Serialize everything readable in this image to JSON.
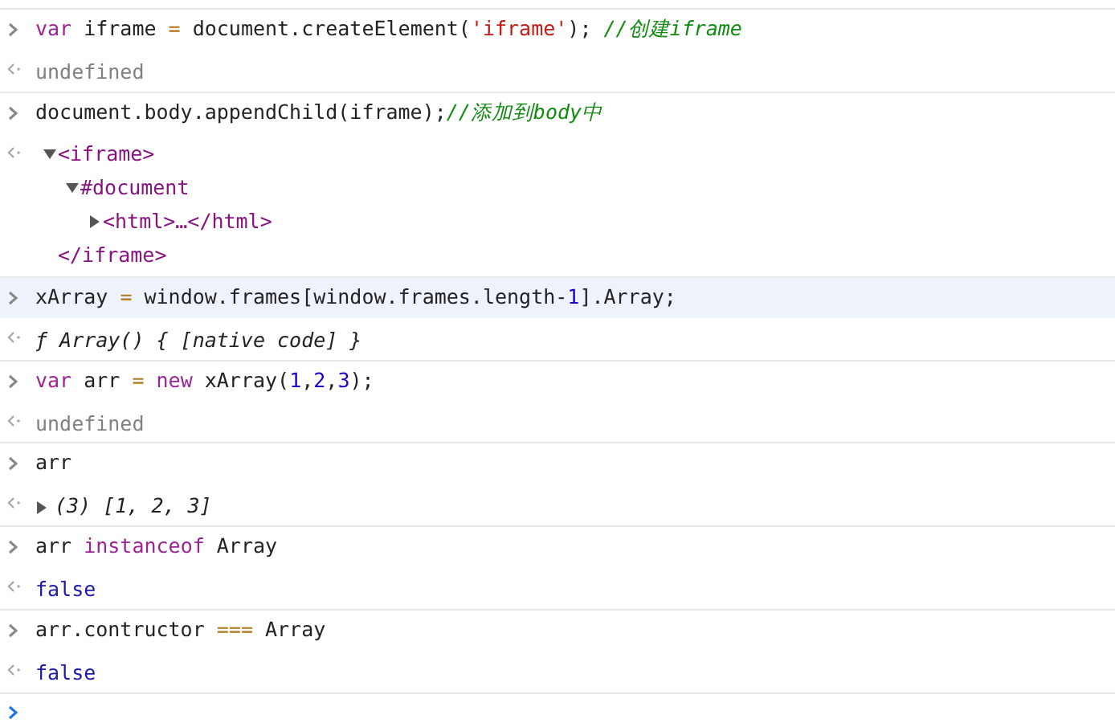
{
  "entries": [
    {
      "selected": false,
      "input": [
        {
          "kind": "keyword",
          "text": "var"
        },
        {
          "kind": "plain",
          "text": " iframe "
        },
        {
          "kind": "operator",
          "text": "="
        },
        {
          "kind": "plain",
          "text": " document.createElement("
        },
        {
          "kind": "string",
          "text": "'iframe'"
        },
        {
          "kind": "plain",
          "text": "); "
        },
        {
          "kind": "comment",
          "text": "//创建iframe"
        }
      ],
      "output": {
        "kind": "undefined",
        "text": "undefined"
      }
    },
    {
      "selected": false,
      "input": [
        {
          "kind": "plain",
          "text": "document.body.appendChild(iframe);"
        },
        {
          "kind": "comment",
          "text": "//添加到body中"
        }
      ],
      "output": {
        "kind": "dom",
        "nodes": [
          {
            "open": "<iframe>",
            "close": "</iframe>",
            "expanded": true,
            "children": [
              {
                "open": "#document",
                "expanded": true,
                "children": [
                  {
                    "open": "<html>…</html>",
                    "expanded": false
                  }
                ]
              }
            ]
          }
        ]
      }
    },
    {
      "selected": true,
      "input": [
        {
          "kind": "plain",
          "text": "xArray "
        },
        {
          "kind": "operator",
          "text": "="
        },
        {
          "kind": "plain",
          "text": " window.frames[window.frames.length-"
        },
        {
          "kind": "number",
          "text": "1"
        },
        {
          "kind": "plain",
          "text": "].Array;"
        }
      ],
      "output": {
        "kind": "function",
        "text": "ƒ Array() { [native code] }"
      }
    },
    {
      "selected": false,
      "input": [
        {
          "kind": "keyword",
          "text": "var"
        },
        {
          "kind": "plain",
          "text": " arr "
        },
        {
          "kind": "operator",
          "text": "= "
        },
        {
          "kind": "keyword",
          "text": "new"
        },
        {
          "kind": "plain",
          "text": " xArray("
        },
        {
          "kind": "number",
          "text": "1"
        },
        {
          "kind": "plain",
          "text": ","
        },
        {
          "kind": "number",
          "text": "2"
        },
        {
          "kind": "plain",
          "text": ","
        },
        {
          "kind": "number",
          "text": "3"
        },
        {
          "kind": "plain",
          "text": ");"
        }
      ],
      "output": {
        "kind": "undefined",
        "text": "undefined"
      }
    },
    {
      "selected": false,
      "input": [
        {
          "kind": "plain",
          "text": "arr"
        }
      ],
      "output": {
        "kind": "array",
        "text": "(3) [1, 2, 3]",
        "expanded": false
      }
    },
    {
      "selected": false,
      "input": [
        {
          "kind": "plain",
          "text": "arr "
        },
        {
          "kind": "keyword",
          "text": "instanceof"
        },
        {
          "kind": "plain",
          "text": " Array"
        }
      ],
      "output": {
        "kind": "boolean",
        "text": "false"
      }
    },
    {
      "selected": false,
      "input": [
        {
          "kind": "plain",
          "text": "arr.contructor "
        },
        {
          "kind": "operator",
          "text": "==="
        },
        {
          "kind": "plain",
          "text": " Array"
        }
      ],
      "output": {
        "kind": "boolean",
        "text": "false"
      }
    }
  ]
}
